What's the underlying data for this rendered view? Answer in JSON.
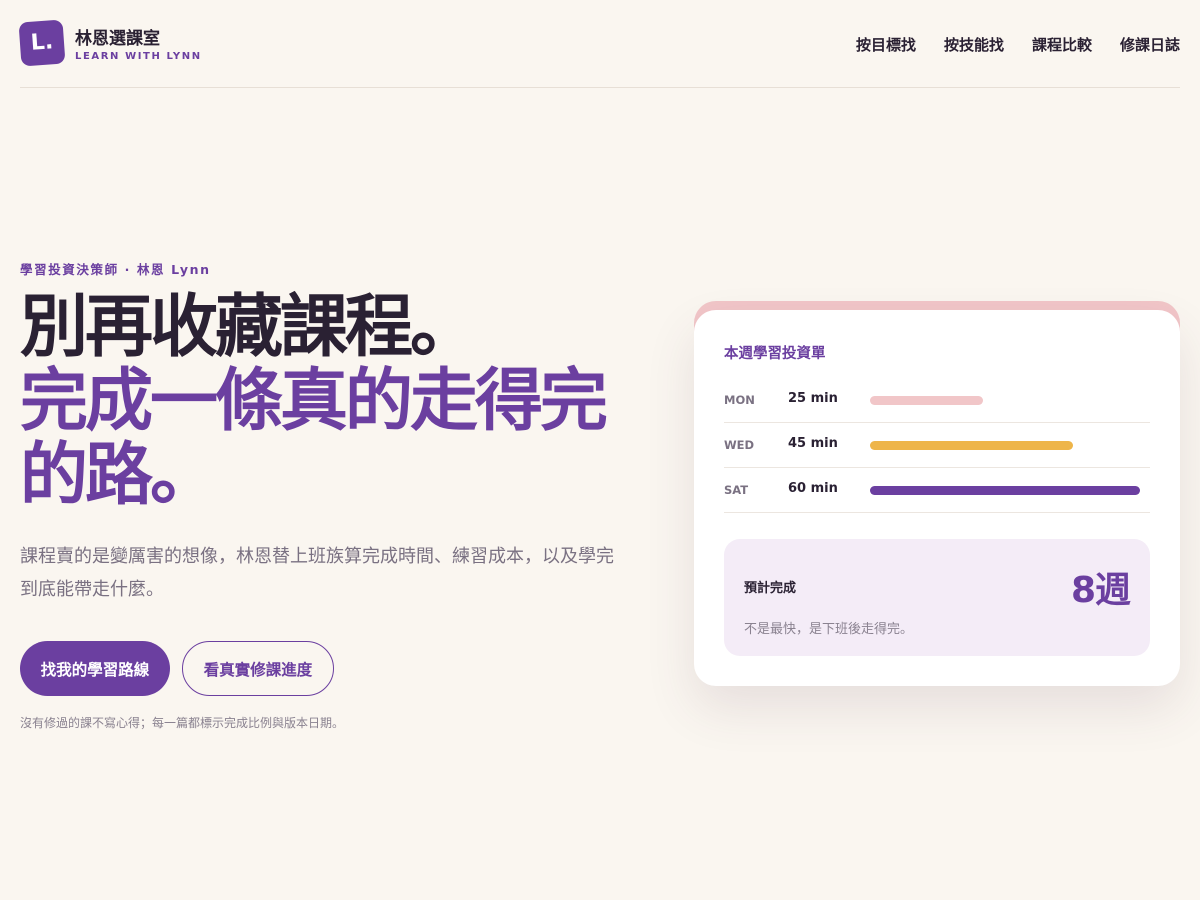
{
  "brand": {
    "mark": "L.",
    "name": "林恩選課室",
    "subtitle": "LEARN WITH LYNN"
  },
  "nav": [
    {
      "label": "按目標找"
    },
    {
      "label": "按技能找"
    },
    {
      "label": "課程比較"
    },
    {
      "label": "修課日誌"
    }
  ],
  "hero": {
    "eyebrow": "學習投資決策師 · 林恩 Lynn",
    "headline_line1": "別再收藏課程。",
    "headline_line2": "完成一條真的走得完的路。",
    "lede": "課程賣的是變厲害的想像，林恩替上班族算完成時間、練習成本，以及學完到底能帶走什麼。",
    "primary_cta": "找我的學習路線",
    "secondary_cta": "看真實修課進度",
    "footnote": "沒有修過的課不寫心得；每一篇都標示完成比例與版本日期。"
  },
  "schedule": {
    "title": "本週學習投資單",
    "rows": [
      {
        "day": "MON",
        "minutes_label": "25 min",
        "minutes": 25,
        "color": "#f1c6c8"
      },
      {
        "day": "WED",
        "minutes_label": "45 min",
        "minutes": 45,
        "color": "#eeb54a"
      },
      {
        "day": "SAT",
        "minutes_label": "60 min",
        "minutes": 60,
        "color": "#6b3fa0"
      }
    ],
    "summary_label": "預計完成",
    "summary_value": "8週",
    "summary_note": "不是最快，是下班後走得完。"
  },
  "colors": {
    "accent": "#6b3fa0",
    "background": "#faf6f0",
    "card_top": "#f1c6c8"
  }
}
